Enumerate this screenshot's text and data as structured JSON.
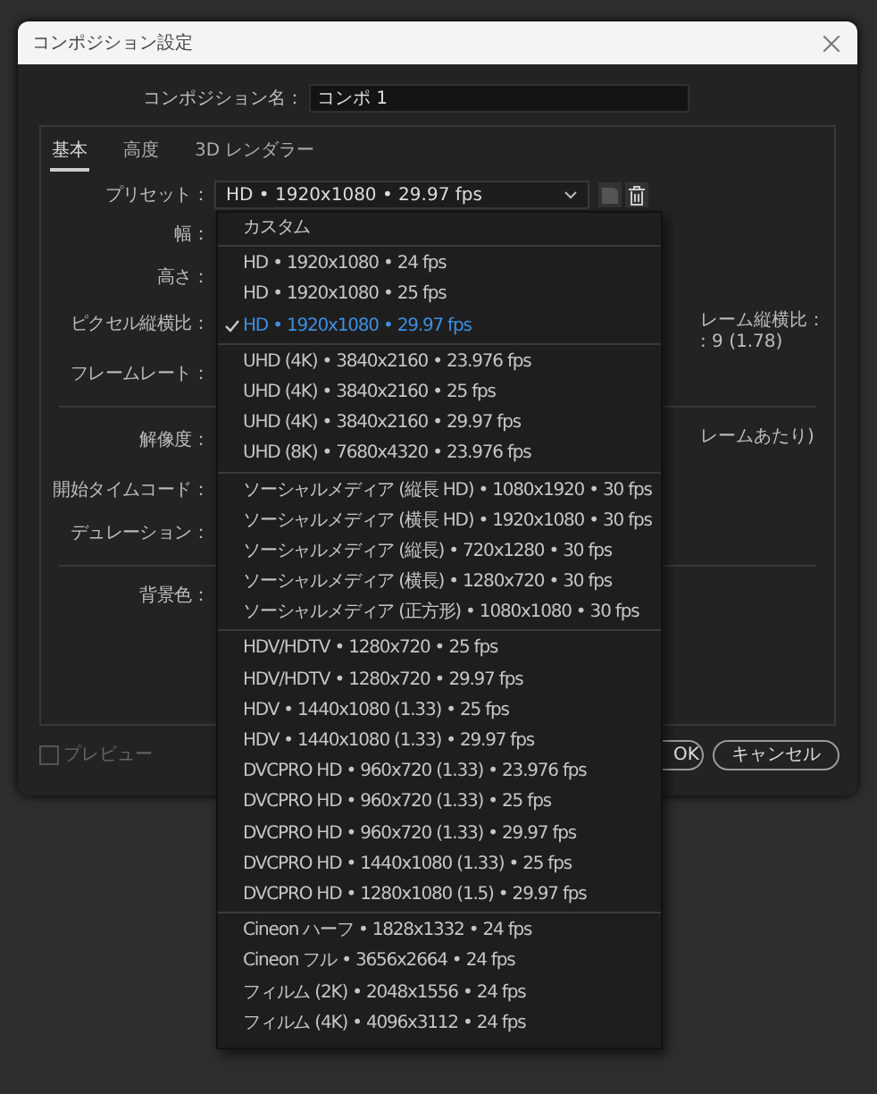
{
  "window": {
    "title": "コンポジション設定"
  },
  "composition_name": {
    "label": "コンポジション名：",
    "value": "コンポ 1"
  },
  "tabs": [
    {
      "label": "基本",
      "selected": true
    },
    {
      "label": "高度",
      "selected": false
    },
    {
      "label": "3D レンダラー",
      "selected": false
    }
  ],
  "preset": {
    "label": "プリセット：",
    "value": "HD • 1920x1080 • 29.97 fps"
  },
  "settings": [
    {
      "kind": "row",
      "label": "幅："
    },
    {
      "kind": "row",
      "label": "高さ："
    },
    {
      "kind": "row",
      "label": "ピクセル縦横比：",
      "side_texts": [
        "レーム縦横比：",
        ": 9 (1.78)"
      ]
    },
    {
      "kind": "row",
      "label": "フレームレート："
    },
    {
      "kind": "divider"
    },
    {
      "kind": "row",
      "label": "解像度：",
      "side_texts": [
        "レームあたり)"
      ]
    },
    {
      "kind": "row",
      "label": "開始タイムコード："
    },
    {
      "kind": "row",
      "label": "デュレーション："
    },
    {
      "kind": "divider"
    },
    {
      "kind": "row",
      "label": "背景色："
    }
  ],
  "preview": {
    "label": "プレビュー",
    "checked": false
  },
  "buttons": [
    {
      "label": "OK",
      "kind": "primary"
    },
    {
      "label": "キャンセル",
      "kind": "secondary"
    }
  ],
  "preset_menu": {
    "groups": [
      {
        "items": [
          {
            "label": "カスタム",
            "selected": false
          }
        ]
      },
      {
        "items": [
          {
            "label": "HD • 1920x1080 • 24 fps",
            "selected": false
          },
          {
            "label": "HD • 1920x1080 • 25 fps",
            "selected": false
          },
          {
            "label": "HD • 1920x1080 • 29.97 fps",
            "selected": true
          }
        ]
      },
      {
        "items": [
          {
            "label": "UHD (4K) • 3840x2160 • 23.976 fps",
            "selected": false
          },
          {
            "label": "UHD (4K) • 3840x2160 • 25 fps",
            "selected": false
          },
          {
            "label": "UHD (4K) • 3840x2160 • 29.97 fps",
            "selected": false
          },
          {
            "label": "UHD (8K) • 7680x4320 • 23.976 fps",
            "selected": false
          }
        ]
      },
      {
        "items": [
          {
            "label": "ソーシャルメディア (縦長 HD) • 1080x1920 • 30 fps",
            "selected": false
          },
          {
            "label": "ソーシャルメディア (横長 HD) • 1920x1080 • 30 fps",
            "selected": false
          },
          {
            "label": "ソーシャルメディア (縦長) • 720x1280 • 30 fps",
            "selected": false
          },
          {
            "label": "ソーシャルメディア (横長) • 1280x720 • 30 fps",
            "selected": false
          },
          {
            "label": "ソーシャルメディア (正方形) • 1080x1080 • 30 fps",
            "selected": false
          }
        ]
      },
      {
        "items": [
          {
            "label": "HDV/HDTV • 1280x720 • 25 fps",
            "selected": false
          },
          {
            "label": "HDV/HDTV • 1280x720 • 29.97 fps",
            "selected": false
          },
          {
            "label": "HDV • 1440x1080 (1.33) • 25 fps",
            "selected": false
          },
          {
            "label": "HDV • 1440x1080 (1.33) • 29.97 fps",
            "selected": false
          },
          {
            "label": "DVCPRO HD • 960x720 (1.33) • 23.976 fps",
            "selected": false
          },
          {
            "label": "DVCPRO HD • 960x720 (1.33) • 25 fps",
            "selected": false
          },
          {
            "label": "DVCPRO HD • 960x720 (1.33) • 29.97 fps",
            "selected": false
          },
          {
            "label": "DVCPRO HD • 1440x1080 (1.33) • 25 fps",
            "selected": false
          },
          {
            "label": "DVCPRO HD • 1280x1080 (1.5) • 29.97 fps",
            "selected": false
          }
        ]
      },
      {
        "items": [
          {
            "label": "Cineon ハーフ • 1828x1332 • 24 fps",
            "selected": false
          },
          {
            "label": "Cineon フル • 3656x2664 • 24 fps",
            "selected": false
          },
          {
            "label": "フィルム (2K) • 2048x1556 • 24 fps",
            "selected": false
          },
          {
            "label": "フィルム (4K) • 4096x3112 • 24 fps",
            "selected": false
          }
        ]
      }
    ]
  }
}
